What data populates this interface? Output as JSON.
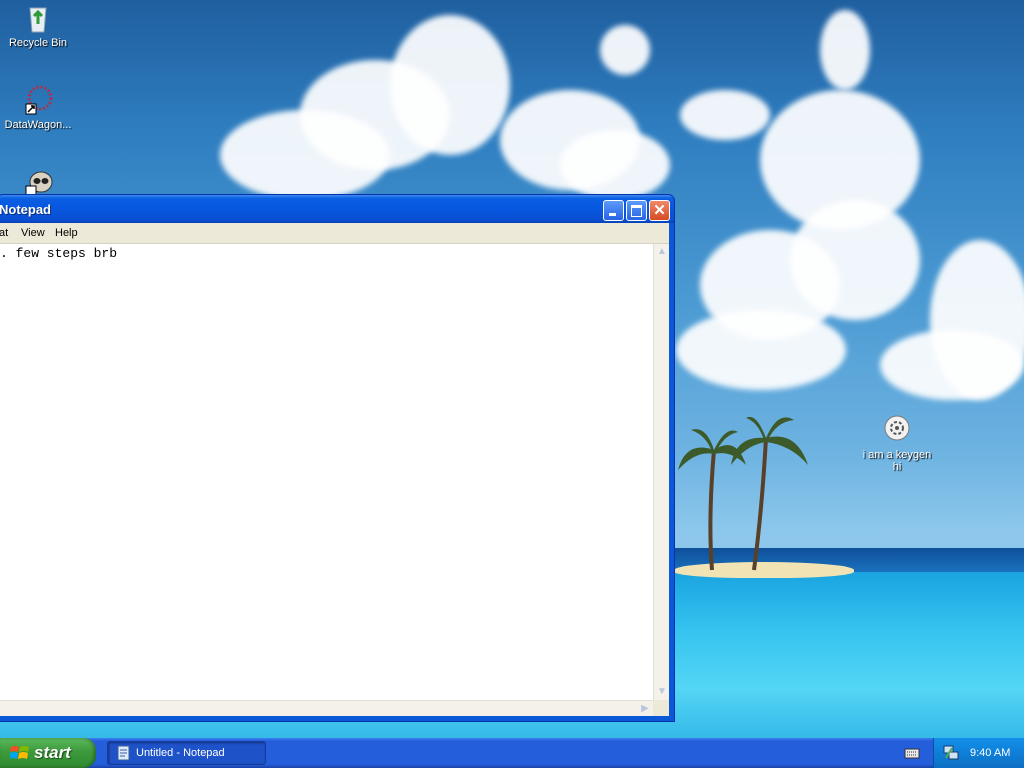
{
  "desktop": {
    "icons": [
      {
        "label": "Recycle Bin",
        "icon": "recycle-bin-icon"
      },
      {
        "label": "DataWagon...",
        "icon": "datawagon-shortcut-icon"
      },
      {
        "label": "",
        "icon": "raccoon-shortcut-icon"
      },
      {
        "label_line1": "i am a keygen",
        "label_line2": "hi",
        "icon": "keygen-file-icon"
      }
    ]
  },
  "notepad": {
    "title": "Notepad",
    "menu": [
      "at",
      "View",
      "Help"
    ],
    "content": ". few steps brb"
  },
  "taskbar": {
    "start_label": "start",
    "tasks": [
      {
        "label": "Untitled - Notepad",
        "icon": "notepad-icon"
      }
    ],
    "clock": "9:40 AM",
    "tray_icons": [
      "keyboard-icon",
      "network-icon"
    ]
  },
  "colors": {
    "taskbar_blue": "#245edb",
    "start_green": "#3c9a3c",
    "titlebar_blue": "#0757e0",
    "menu_bg": "#ece9d8"
  }
}
